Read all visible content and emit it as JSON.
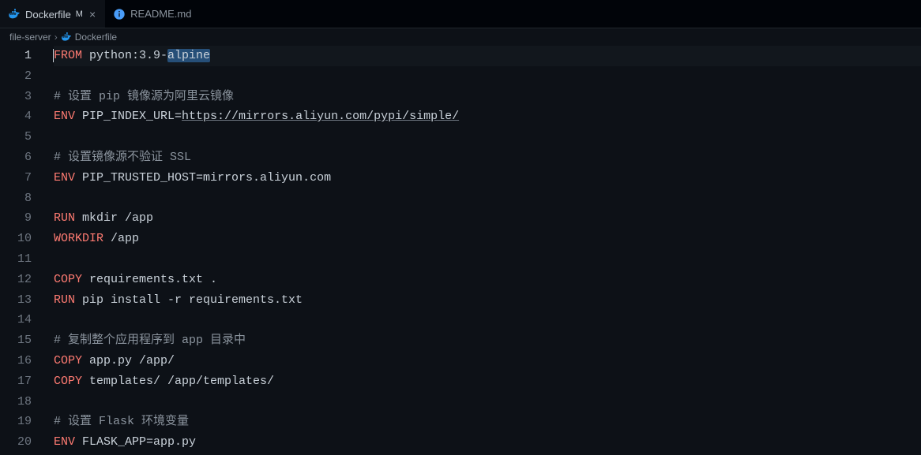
{
  "tabs": [
    {
      "icon": "docker",
      "label": "Dockerfile",
      "badge": "M",
      "active": true
    },
    {
      "icon": "info",
      "label": "README.md",
      "badge": "",
      "active": false
    }
  ],
  "breadcrumb": {
    "parts": [
      "file-server",
      "Dockerfile"
    ],
    "icon": "docker"
  },
  "code": {
    "lines": [
      {
        "n": 1,
        "current": true,
        "tokens": [
          {
            "t": "FROM",
            "c": "kw"
          },
          {
            "t": " python:3.9-",
            "c": "path"
          },
          {
            "t": "alpine",
            "c": "path sel"
          }
        ]
      },
      {
        "n": 2,
        "tokens": []
      },
      {
        "n": 3,
        "tokens": [
          {
            "t": "# 设置 pip 镜像源为阿里云镜像",
            "c": "comment"
          }
        ]
      },
      {
        "n": 4,
        "tokens": [
          {
            "t": "ENV",
            "c": "kw"
          },
          {
            "t": " PIP_INDEX_URL=",
            "c": "path"
          },
          {
            "t": "https://mirrors.aliyun.com/pypi/simple/",
            "c": "url"
          }
        ]
      },
      {
        "n": 5,
        "tokens": []
      },
      {
        "n": 6,
        "tokens": [
          {
            "t": "# 设置镜像源不验证 SSL",
            "c": "comment"
          }
        ]
      },
      {
        "n": 7,
        "tokens": [
          {
            "t": "ENV",
            "c": "kw"
          },
          {
            "t": " PIP_TRUSTED_HOST=mirrors.aliyun.com",
            "c": "path"
          }
        ]
      },
      {
        "n": 8,
        "tokens": []
      },
      {
        "n": 9,
        "tokens": [
          {
            "t": "RUN",
            "c": "kw"
          },
          {
            "t": " mkdir /app",
            "c": "path"
          }
        ]
      },
      {
        "n": 10,
        "tokens": [
          {
            "t": "WORKDIR",
            "c": "kw"
          },
          {
            "t": " /app",
            "c": "path"
          }
        ]
      },
      {
        "n": 11,
        "tokens": []
      },
      {
        "n": 12,
        "tokens": [
          {
            "t": "COPY",
            "c": "kw"
          },
          {
            "t": " requirements.txt .",
            "c": "path"
          }
        ]
      },
      {
        "n": 13,
        "tokens": [
          {
            "t": "RUN",
            "c": "kw"
          },
          {
            "t": " pip install -r requirements.txt",
            "c": "path"
          }
        ]
      },
      {
        "n": 14,
        "tokens": []
      },
      {
        "n": 15,
        "tokens": [
          {
            "t": "# 复制整个应用程序到 app 目录中",
            "c": "comment"
          }
        ]
      },
      {
        "n": 16,
        "tokens": [
          {
            "t": "COPY",
            "c": "kw"
          },
          {
            "t": " app.py /app/",
            "c": "path"
          }
        ]
      },
      {
        "n": 17,
        "tokens": [
          {
            "t": "COPY",
            "c": "kw"
          },
          {
            "t": " templates/ /app/templates/",
            "c": "path"
          }
        ]
      },
      {
        "n": 18,
        "tokens": []
      },
      {
        "n": 19,
        "tokens": [
          {
            "t": "# 设置 Flask 环境变量",
            "c": "comment"
          }
        ]
      },
      {
        "n": 20,
        "tokens": [
          {
            "t": "ENV",
            "c": "kw"
          },
          {
            "t": " FLASK_APP=app.py",
            "c": "path"
          }
        ]
      }
    ]
  }
}
